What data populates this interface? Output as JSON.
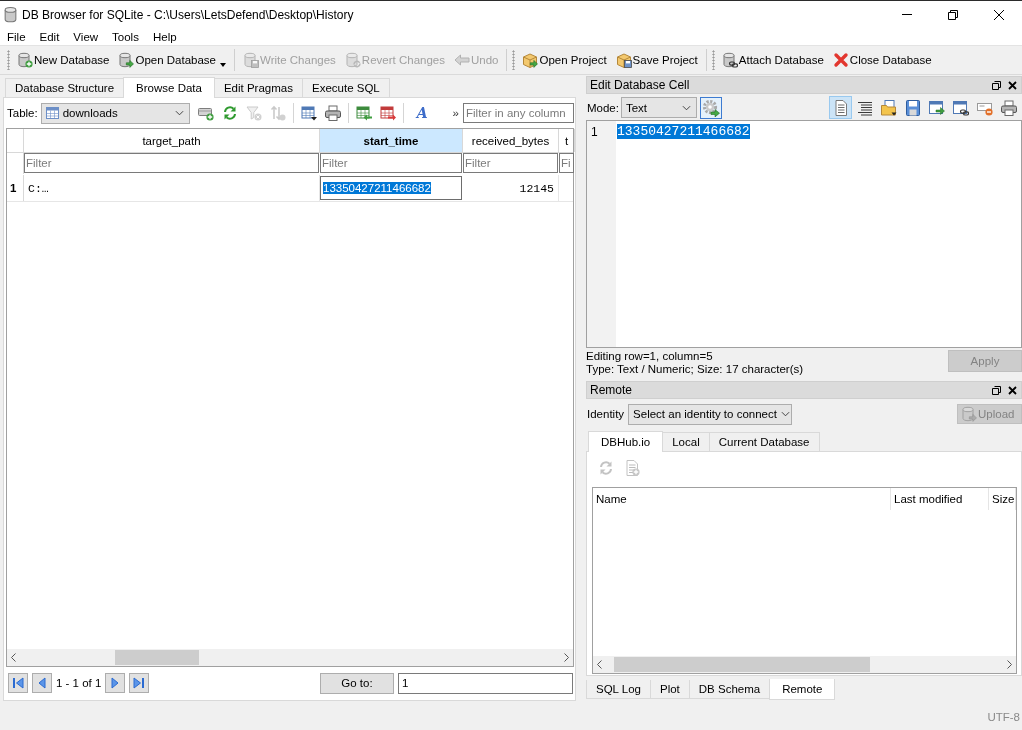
{
  "window": {
    "title": "DB Browser for SQLite - C:\\Users\\LetsDefend\\Desktop\\History"
  },
  "menu": [
    "File",
    "Edit",
    "View",
    "Tools",
    "Help"
  ],
  "toolbar": [
    [
      {
        "label": "New Database",
        "disabled": false,
        "dropdown": false
      },
      {
        "label": "Open Database",
        "disabled": false,
        "dropdown": true
      }
    ],
    [
      {
        "label": "Write Changes",
        "disabled": true,
        "dropdown": false
      },
      {
        "label": "Revert Changes",
        "disabled": true,
        "dropdown": false
      },
      {
        "label": "Undo",
        "disabled": true,
        "dropdown": false
      }
    ],
    [
      {
        "label": "Open Project",
        "disabled": false,
        "dropdown": false
      },
      {
        "label": "Save Project",
        "disabled": false,
        "dropdown": false
      }
    ],
    [
      {
        "label": "Attach Database",
        "disabled": false,
        "dropdown": false
      },
      {
        "label": "Close Database",
        "disabled": false,
        "dropdown": false
      }
    ]
  ],
  "main_tabs": [
    {
      "label": "Database Structure",
      "selected": false
    },
    {
      "label": "Browse Data",
      "selected": true
    },
    {
      "label": "Edit Pragmas",
      "selected": false
    },
    {
      "label": "Execute SQL",
      "selected": false
    }
  ],
  "browse": {
    "table_label": "Table:",
    "table": "downloads",
    "tools": [
      [
        {
          "disabled": false
        },
        {
          "disabled": false
        },
        {
          "disabled": true
        },
        {
          "disabled": true
        }
      ],
      [
        {
          "disabled": false
        },
        {
          "disabled": false
        }
      ],
      [
        {
          "disabled": false
        },
        {
          "disabled": false
        }
      ]
    ],
    "letter_button": {
      "label": "A"
    },
    "overflow": "»",
    "filter": {
      "placeholder": "Filter in any column"
    }
  },
  "grid": {
    "columns": [
      {
        "label": "target_path",
        "selected": false,
        "filter_placeholder": "Filter"
      },
      {
        "label": "start_time",
        "selected": true,
        "filter_placeholder": "Filter"
      },
      {
        "label": "received_bytes",
        "selected": false,
        "filter_placeholder": "Filter"
      },
      {
        "label": "t",
        "selected": false,
        "filter_placeholder": "Fi"
      }
    ],
    "rows": [
      {
        "number": "1",
        "cells": [
          {
            "text": "C:…",
            "kind": "text",
            "selected": false
          },
          {
            "text": "13350427211466682",
            "kind": "text",
            "selected": true
          },
          {
            "text": "12145",
            "kind": "number",
            "selected": false
          }
        ]
      }
    ]
  },
  "pager": {
    "range": "1 - 1 of 1",
    "goto_label": "Go to:",
    "goto_value": "1"
  },
  "edit_cell": {
    "title": "Edit Database Cell",
    "mode_label": "Mode:",
    "mode": "Text",
    "tools": [
      {
        "selected": true
      },
      {
        "selected": false
      },
      {
        "selected": false
      },
      {
        "selected": false
      },
      {
        "selected": false
      },
      {
        "selected": false
      },
      {
        "selected": false
      },
      {
        "selected": false
      }
    ],
    "line": "1",
    "value": "13350427211466682",
    "value_selected": true,
    "editing": "Editing row=1, column=5",
    "type": "Type: Text / Numeric; Size: 17 character(s)",
    "apply": {
      "label": "Apply",
      "disabled": true
    }
  },
  "remote": {
    "title": "Remote",
    "identity_label": "Identity",
    "identity": "Select an identity to connect",
    "upload": {
      "label": "Upload",
      "disabled": true
    },
    "tabs": [
      {
        "label": "DBHub.io",
        "selected": true
      },
      {
        "label": "Local",
        "selected": false
      },
      {
        "label": "Current Database",
        "selected": false
      }
    ],
    "tools": [
      {
        "disabled": true
      },
      {
        "disabled": true
      }
    ],
    "columns": [
      "Name",
      "Last modified",
      "Size"
    ]
  },
  "dock_tabs": [
    {
      "label": "SQL Log",
      "selected": false
    },
    {
      "label": "Plot",
      "selected": false
    },
    {
      "label": "DB Schema",
      "selected": false
    },
    {
      "label": "Remote",
      "selected": true
    }
  ],
  "status_bar": {
    "encoding": "UTF-8"
  }
}
